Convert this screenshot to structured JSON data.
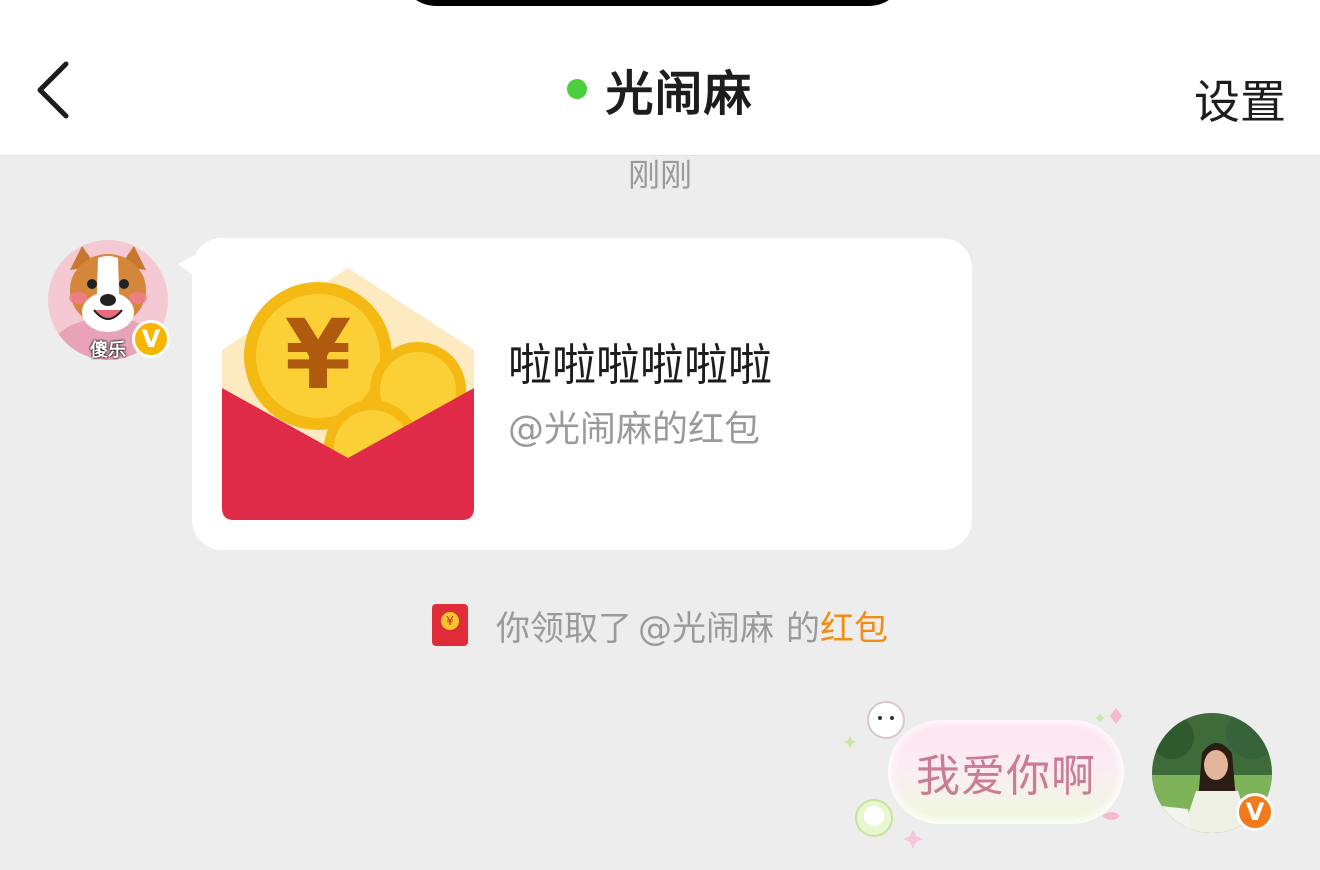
{
  "header": {
    "status_fragment": "",
    "title": "光闹麻",
    "settings_label": "设置",
    "online_color": "#49cf3b"
  },
  "chat": {
    "timestamp": "刚刚",
    "incoming": {
      "avatar_caption": "傻乐",
      "badge": "V",
      "red_packet": {
        "greeting": "啦啦啦啦啦啦",
        "from": "@光闹麻的红包"
      }
    },
    "system_message": {
      "prefix": "你领取了",
      "user": "@光闹麻",
      "middle": "的",
      "link": "红包"
    },
    "outgoing": {
      "text": "我爱你啊",
      "badge": "V"
    }
  },
  "colors": {
    "background": "#ededed",
    "red_packet": "#e02b38",
    "coin": "#f9c52c",
    "link": "#f28c14",
    "badge_yellow": "#f7b500",
    "badge_orange": "#f27a1a"
  },
  "icons": {
    "back": "chevron-left-icon",
    "red_packet": "red-packet-icon",
    "verified": "verified-v-icon"
  }
}
